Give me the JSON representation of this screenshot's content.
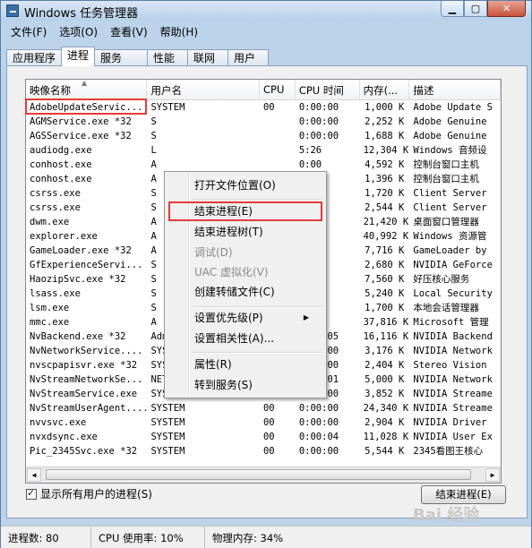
{
  "window": {
    "title": "Windows 任务管理器"
  },
  "menu": [
    "文件(F)",
    "选项(O)",
    "查看(V)",
    "帮助(H)"
  ],
  "tabs": [
    "应用程序",
    "进程",
    "服务",
    "性能",
    "联网",
    "用户"
  ],
  "columns": [
    "映像名称",
    "用户名",
    "CPU",
    "CPU 时间",
    "内存(...",
    "描述"
  ],
  "rows": [
    [
      "AdobeUpdateServic...",
      "SYSTEM",
      "00",
      "0:00:00",
      "1,000 K",
      "Adobe Update S"
    ],
    [
      "AGMService.exe *32",
      "S",
      "",
      "0:00:00",
      "2,252 K",
      "Adobe Genuine"
    ],
    [
      "AGSService.exe *32",
      "S",
      "",
      "0:00:00",
      "1,688 K",
      "Adobe Genuine"
    ],
    [
      "audiodg.exe",
      "L",
      "",
      "5:26",
      "12,304 K",
      "Windows 音频设"
    ],
    [
      "conhost.exe",
      "A",
      "",
      "0:00",
      "4,592 K",
      "控制台窗口主机"
    ],
    [
      "conhost.exe",
      "A",
      "",
      "0:00",
      "1,396 K",
      "控制台窗口主机"
    ],
    [
      "csrss.exe",
      "S",
      "",
      "0:00",
      "1,720 K",
      "Client Server"
    ],
    [
      "csrss.exe",
      "S",
      "",
      "0:28",
      "2,544 K",
      "Client Server"
    ],
    [
      "dwm.exe",
      "A",
      "",
      "0:35",
      "21,420 K",
      "桌面窗口管理器"
    ],
    [
      "explorer.exe",
      "A",
      "",
      "0:38",
      "40,992 K",
      "Windows 资源管"
    ],
    [
      "GameLoader.exe *32",
      "A",
      "",
      "0:05",
      "7,716 K",
      "GameLoader by"
    ],
    [
      "GfExperienceServi...",
      "S",
      "",
      "0:00",
      "2,680 K",
      "NVIDIA GeForce"
    ],
    [
      "HaozipSvc.exe *32",
      "S",
      "",
      "0:42",
      "7,560 K",
      "好压核心服务"
    ],
    [
      "lsass.exe",
      "S",
      "",
      "0:06",
      "5,240 K",
      "Local Security"
    ],
    [
      "lsm.exe",
      "S",
      "",
      "0:00",
      "1,700 K",
      "本地会话管理器"
    ],
    [
      "mmc.exe",
      "A",
      "",
      "0:01",
      "37,816 K",
      "Microsoft 管理"
    ],
    [
      "NvBackend.exe *32",
      "Administrator",
      "00",
      "0:00:05",
      "16,116 K",
      "NVIDIA Backend"
    ],
    [
      "NvNetworkService....",
      "SYSTEM",
      "00",
      "0:00:00",
      "3,176 K",
      "NVIDIA Network"
    ],
    [
      "nvscpapisvr.exe *32",
      "SYSTEM",
      "00",
      "0:00:00",
      "2,404 K",
      "Stereo Vision"
    ],
    [
      "NvStreamNetworkSe...",
      "NETWORK SERVICE",
      "00",
      "0:00:01",
      "5,000 K",
      "NVIDIA Network"
    ],
    [
      "NvStreamService.exe",
      "SYSTEM",
      "00",
      "0:00:00",
      "3,852 K",
      "NVIDIA Streame"
    ],
    [
      "NvStreamUserAgent....",
      "SYSTEM",
      "00",
      "0:00:00",
      "24,340 K",
      "NVIDIA Streame"
    ],
    [
      "nvvsvc.exe",
      "SYSTEM",
      "00",
      "0:00:00",
      "2,904 K",
      "NVIDIA Driver"
    ],
    [
      "nvxdsync.exe",
      "SYSTEM",
      "00",
      "0:00:04",
      "11,028 K",
      "NVIDIA User Ex"
    ],
    [
      "Pic_2345Svc.exe *32",
      "SYSTEM",
      "00",
      "0:00:00",
      "5,544 K",
      "2345看图王核心"
    ]
  ],
  "context_menu": {
    "items": [
      "打开文件位置(O)",
      "结束进程(E)",
      "结束进程树(T)",
      "调试(D)",
      "UAC 虚拟化(V)",
      "创建转储文件(C)",
      "设置优先级(P)",
      "设置相关性(A)...",
      "属性(R)",
      "转到服务(S)"
    ]
  },
  "show_all_users_label": "显示所有用户的进程(S)",
  "end_process_button": "结束进程(E)",
  "status": {
    "processes": "进程数: 80",
    "cpu": "CPU 使用率: 10%",
    "memory": "物理内存: 34%"
  },
  "watermark": "Bai 经验"
}
